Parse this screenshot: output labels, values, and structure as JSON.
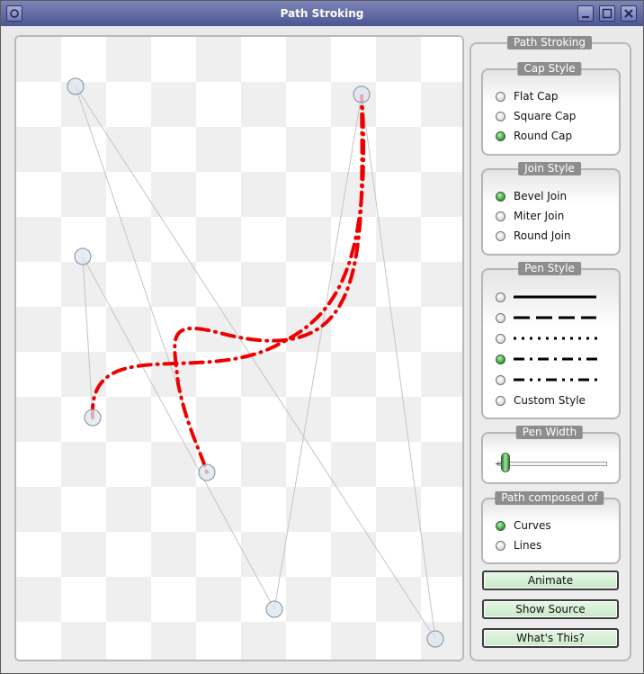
{
  "window": {
    "title": "Path Stroking"
  },
  "panel": {
    "title": "Path Stroking",
    "cap_style": {
      "title": "Cap Style",
      "options": [
        {
          "label": "Flat Cap",
          "checked": false
        },
        {
          "label": "Square Cap",
          "checked": false
        },
        {
          "label": "Round Cap",
          "checked": true
        }
      ]
    },
    "join_style": {
      "title": "Join Style",
      "options": [
        {
          "label": "Bevel Join",
          "checked": true
        },
        {
          "label": "Miter Join",
          "checked": false
        },
        {
          "label": "Round Join",
          "checked": false
        }
      ]
    },
    "pen_style": {
      "title": "Pen Style",
      "options": [
        {
          "pattern": "solid",
          "checked": false
        },
        {
          "pattern": "dash",
          "checked": false
        },
        {
          "pattern": "dot",
          "checked": false
        },
        {
          "pattern": "dash-dot",
          "checked": true
        },
        {
          "pattern": "dash-dot-dot",
          "checked": false
        },
        {
          "label": "Custom Style",
          "checked": false
        }
      ]
    },
    "pen_width": {
      "title": "Pen Width",
      "value_fraction": 0.05
    },
    "path_composed_of": {
      "title": "Path composed of",
      "options": [
        {
          "label": "Curves",
          "checked": true
        },
        {
          "label": "Lines",
          "checked": false
        }
      ]
    },
    "buttons": {
      "animate": "Animate",
      "show_source": "Show Source",
      "whats_this": "What's This?"
    }
  },
  "colors": {
    "stroke": "#ee0000",
    "control_line": "#c4c4c4",
    "checker_dark": "#efefef",
    "titlebar": "#5c64a0"
  }
}
